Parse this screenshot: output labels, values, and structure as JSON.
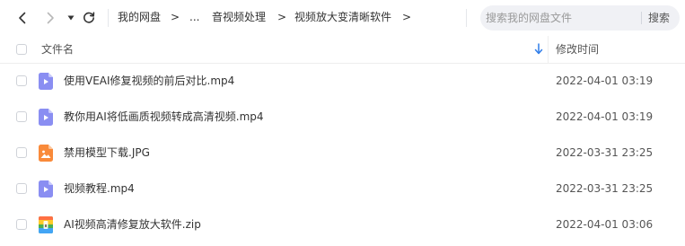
{
  "toolbar": {
    "back_icon": "chevron-left-icon",
    "forward_icon": "chevron-right-icon",
    "history_icon": "caret-down-icon",
    "refresh_icon": "refresh-icon"
  },
  "breadcrumb": {
    "items": [
      "我的网盘",
      "...",
      "音视频处理",
      "视频放大变清晰软件"
    ],
    "separator": ">"
  },
  "search": {
    "placeholder": "搜索我的网盘文件",
    "button_label": "搜索"
  },
  "table": {
    "header": {
      "name": "文件名",
      "modified": "修改时间",
      "sort_icon": "arrow-down-icon"
    },
    "rows": [
      {
        "name": "使用VEAI修复视频的前后对比.mp4",
        "modified": "2022-04-01 03:19",
        "icon": "video-file-icon"
      },
      {
        "name": "教你用AI将低画质视频转成高清视频.mp4",
        "modified": "2022-04-01 03:19",
        "icon": "video-file-icon"
      },
      {
        "name": "禁用模型下载.JPG",
        "modified": "2022-03-31 23:25",
        "icon": "image-file-icon"
      },
      {
        "name": "视频教程.mp4",
        "modified": "2022-03-31 23:25",
        "icon": "video-file-icon"
      },
      {
        "name": "AI视频高清修复放大软件.zip",
        "modified": "2022-04-01 03:06",
        "icon": "zip-file-icon"
      }
    ]
  },
  "colors": {
    "video_icon": "#8a8ef2",
    "image_icon": "#f98a3a",
    "sort_arrow": "#2f7de9",
    "search_bg": "#f0f1f5"
  }
}
